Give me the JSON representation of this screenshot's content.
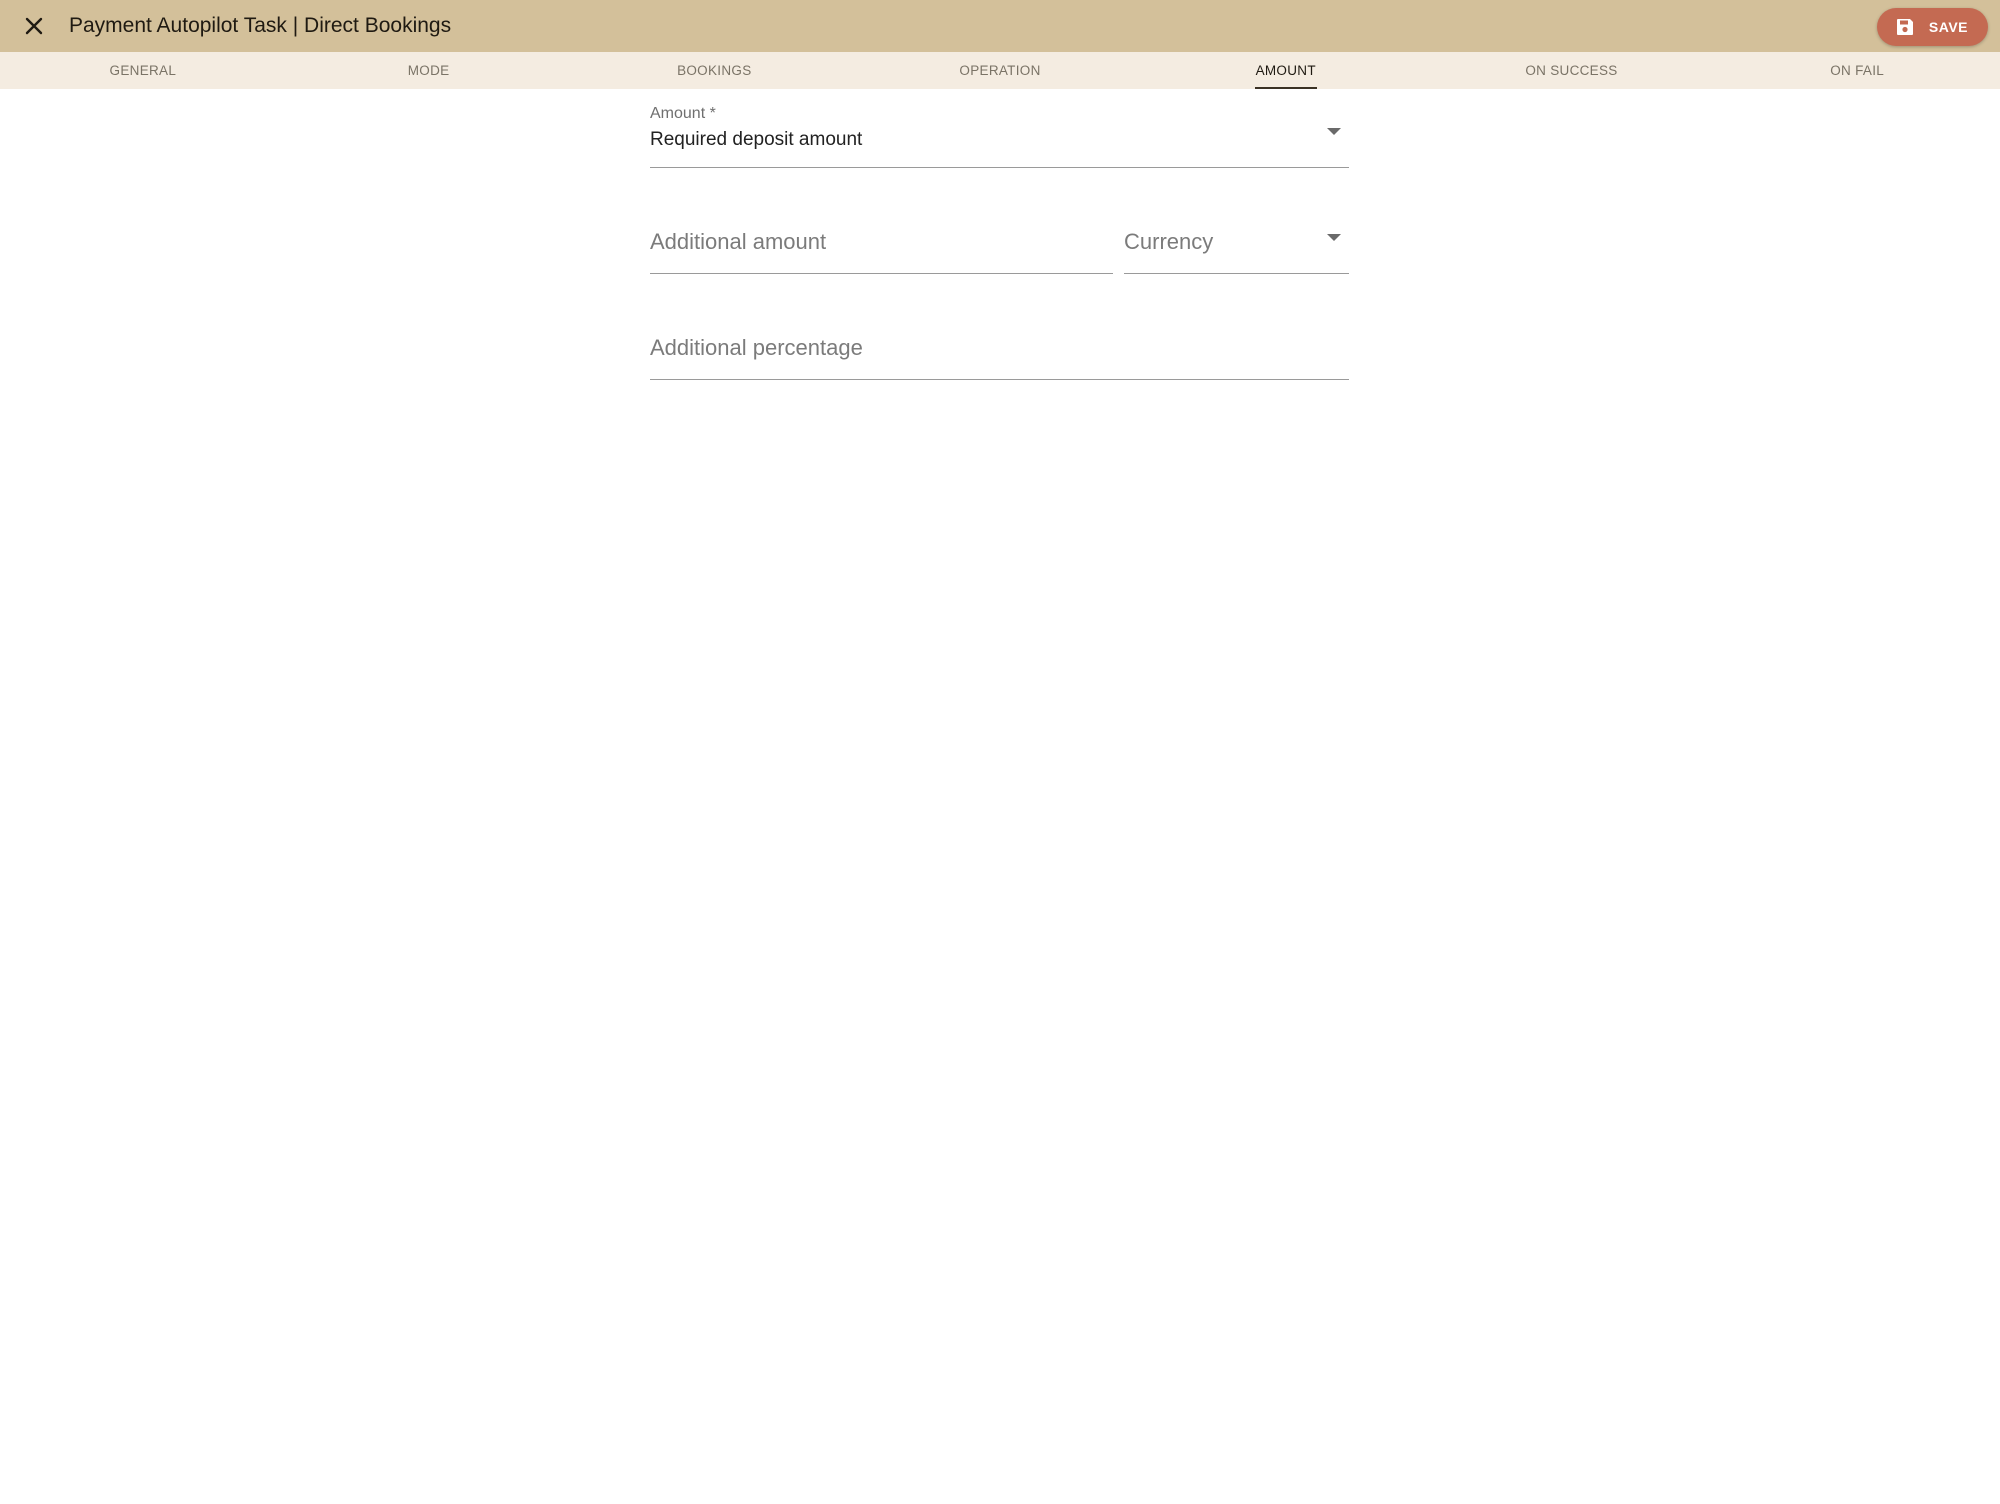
{
  "header": {
    "title": "Payment Autopilot Task | Direct Bookings",
    "save_label": "SAVE"
  },
  "tabs": [
    {
      "label": "GENERAL",
      "active": false
    },
    {
      "label": "MODE",
      "active": false
    },
    {
      "label": "BOOKINGS",
      "active": false
    },
    {
      "label": "OPERATION",
      "active": false
    },
    {
      "label": "AMOUNT",
      "active": true
    },
    {
      "label": "ON SUCCESS",
      "active": false
    },
    {
      "label": "ON FAIL",
      "active": false
    }
  ],
  "form": {
    "amount": {
      "label": "Amount *",
      "value": "Required deposit amount"
    },
    "additional_amount": {
      "placeholder": "Additional amount"
    },
    "currency": {
      "placeholder": "Currency"
    },
    "additional_percentage": {
      "placeholder": "Additional percentage"
    }
  },
  "colors": {
    "app_bar": "#d3c09a",
    "tab_bar": "#f4ece1",
    "save_button": "#c46a52"
  },
  "icons": {
    "close": "close-icon",
    "save": "floppy-disk-icon",
    "dropdown": "caret-down-icon"
  }
}
